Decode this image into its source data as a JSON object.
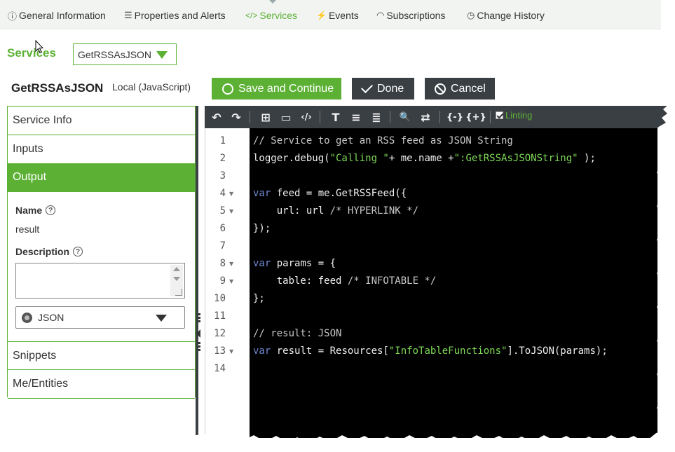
{
  "tabs": [
    {
      "icon": "info-icon",
      "glyph": "ⓘ",
      "label": "General Information",
      "active": false
    },
    {
      "icon": "list-icon",
      "glyph": "☰",
      "label": "Properties and Alerts",
      "active": false
    },
    {
      "icon": "code-icon",
      "glyph": "</>",
      "label": "Services",
      "active": true
    },
    {
      "icon": "bolt-icon",
      "glyph": "⚡",
      "label": "Events",
      "active": false
    },
    {
      "icon": "rss-icon",
      "glyph": "◠",
      "label": "Subscriptions",
      "active": false
    },
    {
      "icon": "history-icon",
      "glyph": "◷",
      "label": "Change History",
      "active": false
    }
  ],
  "services": {
    "label": "Services",
    "selected": "GetRSSAsJSON"
  },
  "service": {
    "name": "GetRSSAsJSON",
    "type": "Local (JavaScript)"
  },
  "actions": {
    "save_label": "Save and Continue",
    "done_label": "Done",
    "cancel_label": "Cancel"
  },
  "left_panel": {
    "items": [
      "Service Info",
      "Inputs",
      "Output",
      "Snippets",
      "Me/Entities"
    ],
    "active": "Output",
    "output": {
      "name_label": "Name",
      "name_value": "result",
      "description_label": "Description",
      "description_value": "",
      "base_type": "JSON"
    }
  },
  "editor": {
    "toolbar": [
      {
        "name": "undo-icon",
        "glyph": "↶"
      },
      {
        "name": "redo-icon",
        "glyph": "↷"
      },
      {
        "name": "add-icon",
        "glyph": "⊞"
      },
      {
        "name": "comment-icon",
        "glyph": "▭"
      },
      {
        "name": "code-icon",
        "glyph": "‹/›"
      },
      {
        "name": "format-text-icon",
        "glyph": "T"
      },
      {
        "name": "indent-icon",
        "glyph": "≡"
      },
      {
        "name": "outdent-icon",
        "glyph": "≣"
      },
      {
        "name": "search-icon",
        "glyph": "🔍"
      },
      {
        "name": "replace-icon",
        "glyph": "⇄"
      },
      {
        "name": "braces-icon",
        "glyph": "{-}"
      },
      {
        "name": "braces-plus-icon",
        "glyph": "{+}"
      }
    ],
    "linting_label": "Linting",
    "linting_checked": true,
    "lines": [
      {
        "n": "1",
        "fold": false,
        "tokens": [
          {
            "c": "cm",
            "t": "// Service to get an RSS feed as JSON String"
          }
        ]
      },
      {
        "n": "2",
        "fold": false,
        "tokens": [
          {
            "c": "",
            "t": "logger.debug("
          },
          {
            "c": "st",
            "t": "\"Calling \""
          },
          {
            "c": "",
            "t": "+ me.name +"
          },
          {
            "c": "st",
            "t": "\":GetRSSAsJSONString\""
          },
          {
            "c": "",
            "t": " );"
          }
        ]
      },
      {
        "n": "3",
        "fold": false,
        "tokens": []
      },
      {
        "n": "4",
        "fold": true,
        "tokens": [
          {
            "c": "kw",
            "t": "var"
          },
          {
            "c": "",
            "t": " feed = me.GetRSSFeed({"
          }
        ]
      },
      {
        "n": "5",
        "fold": true,
        "tokens": [
          {
            "c": "",
            "t": "    url: url "
          },
          {
            "c": "cm",
            "t": "/* HYPERLINK */"
          }
        ]
      },
      {
        "n": "6",
        "fold": false,
        "tokens": [
          {
            "c": "",
            "t": "});"
          }
        ]
      },
      {
        "n": "7",
        "fold": false,
        "tokens": []
      },
      {
        "n": "8",
        "fold": true,
        "tokens": [
          {
            "c": "kw",
            "t": "var"
          },
          {
            "c": "",
            "t": " params = {"
          }
        ]
      },
      {
        "n": "9",
        "fold": true,
        "tokens": [
          {
            "c": "",
            "t": "    table: feed "
          },
          {
            "c": "cm",
            "t": "/* INFOTABLE */"
          }
        ]
      },
      {
        "n": "10",
        "fold": false,
        "tokens": [
          {
            "c": "",
            "t": "};"
          }
        ]
      },
      {
        "n": "11",
        "fold": false,
        "tokens": []
      },
      {
        "n": "12",
        "fold": false,
        "tokens": [
          {
            "c": "cm",
            "t": "// result: JSON"
          }
        ]
      },
      {
        "n": "13",
        "fold": true,
        "tokens": [
          {
            "c": "kw",
            "t": "var"
          },
          {
            "c": "",
            "t": " result = Resources["
          },
          {
            "c": "st",
            "t": "\"InfoTableFunctions\""
          },
          {
            "c": "",
            "t": "].ToJSON(params);"
          }
        ]
      },
      {
        "n": "14",
        "fold": false,
        "tokens": []
      }
    ]
  },
  "colors": {
    "accent": "#5cb135",
    "dark": "#3a3f44",
    "editor_bg": "#000000"
  }
}
